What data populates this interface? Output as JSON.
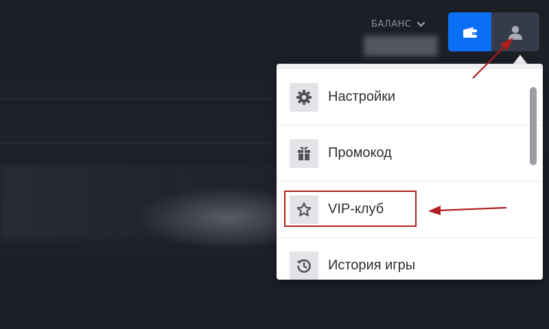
{
  "header": {
    "balance_label": "БАЛАНС",
    "icons": {
      "balance_chevron": "chevron-down-icon",
      "wallet": "wallet-icon",
      "profile": "user-icon"
    },
    "colors": {
      "wallet_button": "#0b6ff5",
      "profile_button": "#353b48"
    }
  },
  "dropdown": {
    "items": [
      {
        "label": "Настройки",
        "icon": "gear-icon"
      },
      {
        "label": "Промокод",
        "icon": "gift-icon"
      },
      {
        "label": "VIP-клуб",
        "icon": "star-icon"
      },
      {
        "label": "История игры",
        "icon": "history-icon"
      }
    ]
  },
  "annotations": {
    "highlighted_item": "VIP-клуб",
    "pointed_button": "profile",
    "color": "#b01d1d"
  }
}
